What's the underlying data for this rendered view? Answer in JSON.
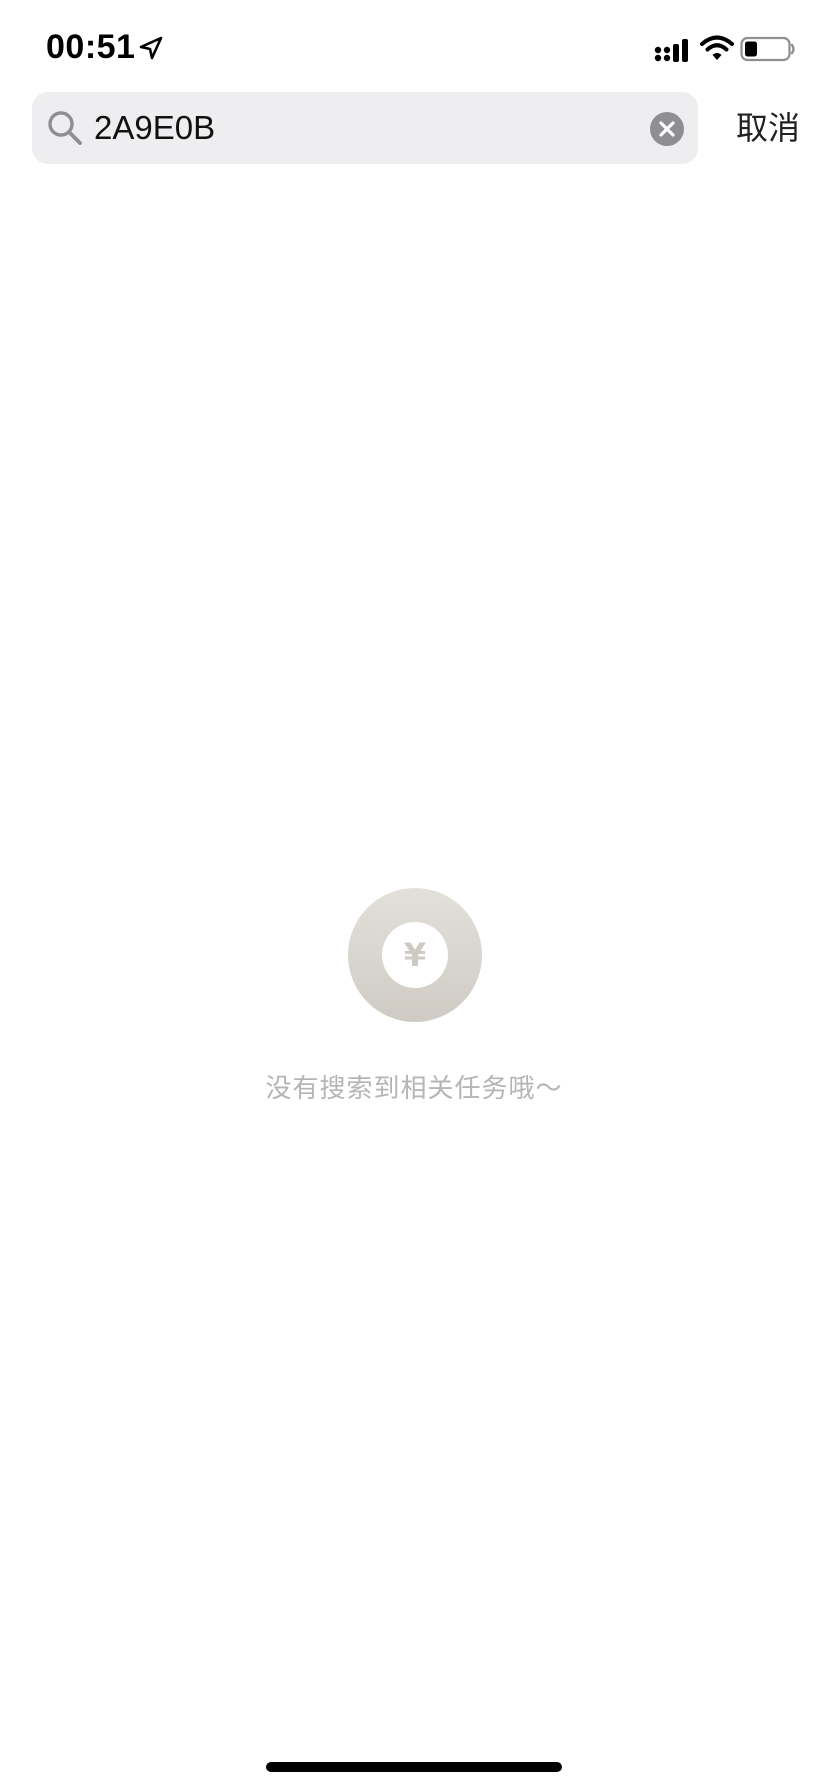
{
  "status_bar": {
    "time": "00:51",
    "icons": [
      "location-arrow-icon",
      "cellular-signal-icon",
      "wifi-icon",
      "battery-icon"
    ]
  },
  "search": {
    "query": "2A9E0B",
    "cancel_label": "取消",
    "icons": [
      "search-icon",
      "clear-icon"
    ]
  },
  "empty_state": {
    "symbol": "¥",
    "message": "没有搜索到相关任务哦～",
    "icon": "coin-icon"
  },
  "colors": {
    "search_bg": "#eeeef0",
    "clear_icon": "#8e8e93",
    "empty_text": "#b5b5b8",
    "coin_ring": "#d9d5cf"
  }
}
